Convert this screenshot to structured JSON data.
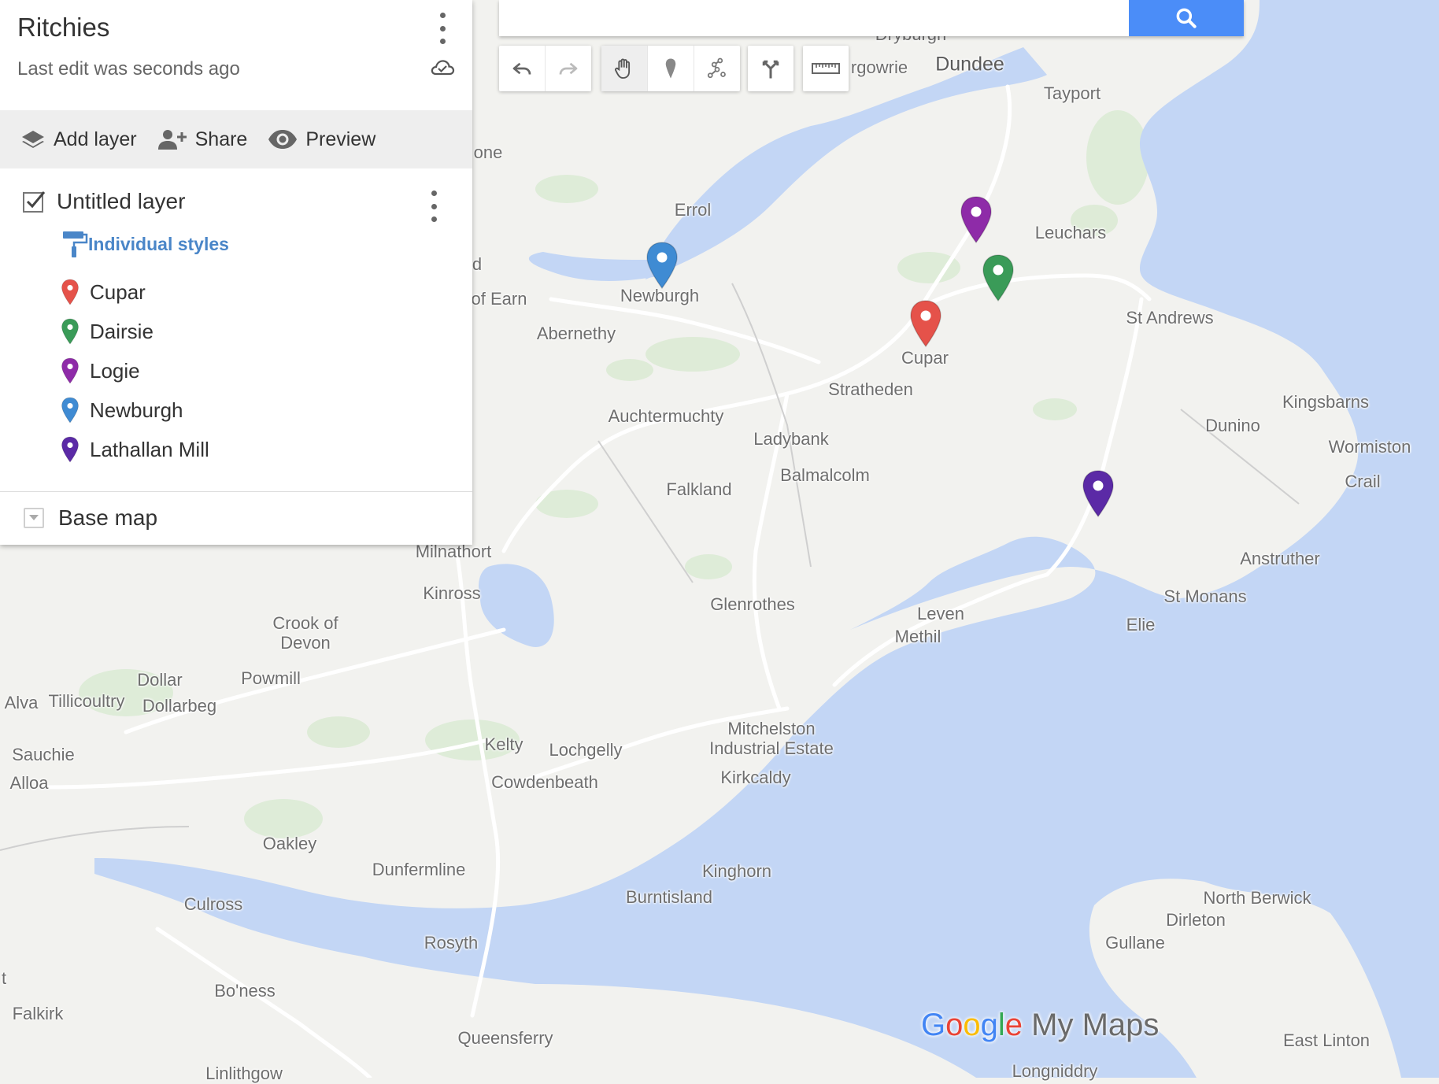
{
  "map": {
    "colors": {
      "water": "#c3d6f5",
      "land": "#f2f2ef",
      "green": "#dcebd5",
      "road": "#ffffff"
    },
    "places": [
      {
        "name": "Dryburgh",
        "k": "p0"
      },
      {
        "name": "Dundee",
        "k": "p1"
      },
      {
        "name": "rgowrie",
        "k": "p2"
      },
      {
        "name": "Tayport",
        "k": "p3"
      },
      {
        "name": "one",
        "k": "p4"
      },
      {
        "name": "Errol",
        "k": "p5"
      },
      {
        "name": "Leuchars",
        "k": "p6"
      },
      {
        "name": "d",
        "k": "p7"
      },
      {
        "name": "of Earn",
        "k": "p8"
      },
      {
        "name": "Newburgh",
        "k": "p9"
      },
      {
        "name": "Abernethy",
        "k": "p10"
      },
      {
        "name": "St Andrews",
        "k": "p11"
      },
      {
        "name": "Cupar",
        "k": "p12"
      },
      {
        "name": "Stratheden",
        "k": "p13"
      },
      {
        "name": "Kingsbarns",
        "k": "p14"
      },
      {
        "name": "Auchtermuchty",
        "k": "p15"
      },
      {
        "name": "Dunino",
        "k": "p16"
      },
      {
        "name": "Ladybank",
        "k": "p17"
      },
      {
        "name": "Wormiston",
        "k": "p18"
      },
      {
        "name": "Balmalcolm",
        "k": "p19"
      },
      {
        "name": "Falkland",
        "k": "p20"
      },
      {
        "name": "Crail",
        "k": "p21"
      },
      {
        "name": "Milnathort",
        "k": "p22"
      },
      {
        "name": "Anstruther",
        "k": "p23"
      },
      {
        "name": "Kinross",
        "k": "p24"
      },
      {
        "name": "St Monans",
        "k": "p25"
      },
      {
        "name": "Glenrothes",
        "k": "p26"
      },
      {
        "name": "Crook of\nDevon",
        "k": "p27"
      },
      {
        "name": "Leven",
        "k": "p28"
      },
      {
        "name": "Elie",
        "k": "p29"
      },
      {
        "name": "Methil",
        "k": "p30"
      },
      {
        "name": "Dollar",
        "k": "p31"
      },
      {
        "name": "Powmill",
        "k": "p32"
      },
      {
        "name": "Alva",
        "k": "p33"
      },
      {
        "name": "Tillicoultry",
        "k": "p34"
      },
      {
        "name": "Dollarbeg",
        "k": "p35"
      },
      {
        "name": "Mitchelston\nIndustrial Estate",
        "k": "p36"
      },
      {
        "name": "Kelty",
        "k": "p37"
      },
      {
        "name": "Lochgelly",
        "k": "p38"
      },
      {
        "name": "Sauchie",
        "k": "p39"
      },
      {
        "name": "Cowdenbeath",
        "k": "p40"
      },
      {
        "name": "Kirkcaldy",
        "k": "p41"
      },
      {
        "name": "Alloa",
        "k": "p42"
      },
      {
        "name": "Oakley",
        "k": "p43"
      },
      {
        "name": "Dunfermline",
        "k": "p44"
      },
      {
        "name": "Kinghorn",
        "k": "p45"
      },
      {
        "name": "North Berwick",
        "k": "p46"
      },
      {
        "name": "Burntisland",
        "k": "p47"
      },
      {
        "name": "Culross",
        "k": "p48"
      },
      {
        "name": "Dirleton",
        "k": "p49"
      },
      {
        "name": "Rosyth",
        "k": "p50"
      },
      {
        "name": "Gullane",
        "k": "p51"
      },
      {
        "name": "Bo'ness",
        "k": "p52"
      },
      {
        "name": "Falkirk",
        "k": "p53"
      },
      {
        "name": "Queensferry",
        "k": "p54"
      },
      {
        "name": "East Linton",
        "k": "p55"
      },
      {
        "name": "Longniddry",
        "k": "p56"
      },
      {
        "name": "Linlithgow",
        "k": "p57"
      },
      {
        "name": "t",
        "k": "p58"
      }
    ],
    "markers": [
      {
        "name": "Newburgh",
        "color": "#3f8bd3"
      },
      {
        "name": "Logie",
        "color": "#8e2ba8"
      },
      {
        "name": "Dairsie",
        "color": "#3a9b58"
      },
      {
        "name": "Cupar",
        "color": "#e5524a"
      },
      {
        "name": "Lathallan Mill",
        "color": "#5b2aa6"
      }
    ]
  },
  "panel": {
    "title": "Ritchies",
    "subtitle": "Last edit was seconds ago",
    "actions": {
      "add_layer": "Add layer",
      "share": "Share",
      "preview": "Preview"
    },
    "layer": {
      "name": "Untitled layer",
      "checked": true,
      "style_link": "Individual styles",
      "items": [
        {
          "label": "Cupar",
          "color": "#e5524a"
        },
        {
          "label": "Dairsie",
          "color": "#3a9b58"
        },
        {
          "label": "Logie",
          "color": "#8e2ba8"
        },
        {
          "label": "Newburgh",
          "color": "#3f8bd3"
        },
        {
          "label": "Lathallan Mill",
          "color": "#5b2aa6"
        }
      ]
    },
    "base_map": "Base map"
  },
  "toolbar": {
    "tools": [
      "undo-icon",
      "redo-icon",
      "hand-icon",
      "marker-icon",
      "draw-line-icon",
      "directions-icon",
      "ruler-icon"
    ],
    "search_color": "#4b8df8"
  },
  "branding": {
    "google": "Google",
    "product": "My Maps"
  }
}
